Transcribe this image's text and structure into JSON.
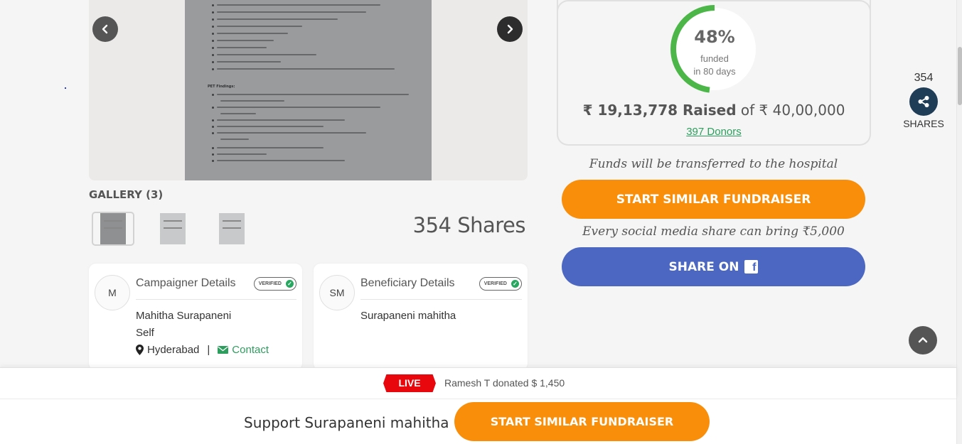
{
  "gallery": {
    "title": "GALLERY (3)",
    "shares_text": "354 Shares",
    "document": {
      "heading": "PET Findings:"
    }
  },
  "campaigner": {
    "title": "Campaigner Details",
    "initials": "M",
    "verified": "VERIFIED",
    "name": "Mahitha Surapaneni",
    "relation": "Self",
    "location": "Hyderabad",
    "separator": "|",
    "contact": "Contact"
  },
  "beneficiary": {
    "title": "Beneficiary Details",
    "initials": "SM",
    "verified": "VERIFIED",
    "name": "Surapaneni mahitha"
  },
  "funding": {
    "percent": 48,
    "percent_label": "48%",
    "funded_line1": "funded",
    "funded_line2": "in 80 days",
    "raised_amount": "₹ 19,13,778 Raised",
    "of_text": "of ₹ 40,00,000",
    "donors": "397 Donors",
    "ring_color": "#4cb748",
    "ring_track_color": "#ffffff"
  },
  "actions": {
    "transfer_note": "Funds will be transferred to the hospital",
    "start_fundraiser": "START SIMILAR FUNDRAISER",
    "share_note": "Every social media share can bring ₹5,000",
    "share_on": "SHARE ON",
    "facebook_glyph": "f"
  },
  "share_widget": {
    "count": "354",
    "label": "SHARES"
  },
  "live_bar": {
    "badge": "LIVE",
    "text": "Ramesh T donated $ 1,450"
  },
  "support_bar": {
    "text": "Support Surapaneni mahitha",
    "button": "START SIMILAR FUNDRAISER"
  },
  "colors": {
    "orange": "#f98e0a",
    "facebook": "#4b67c1",
    "green": "#2e9e5e",
    "live_red": "#e8070d",
    "share_navy": "#1f3d56"
  }
}
